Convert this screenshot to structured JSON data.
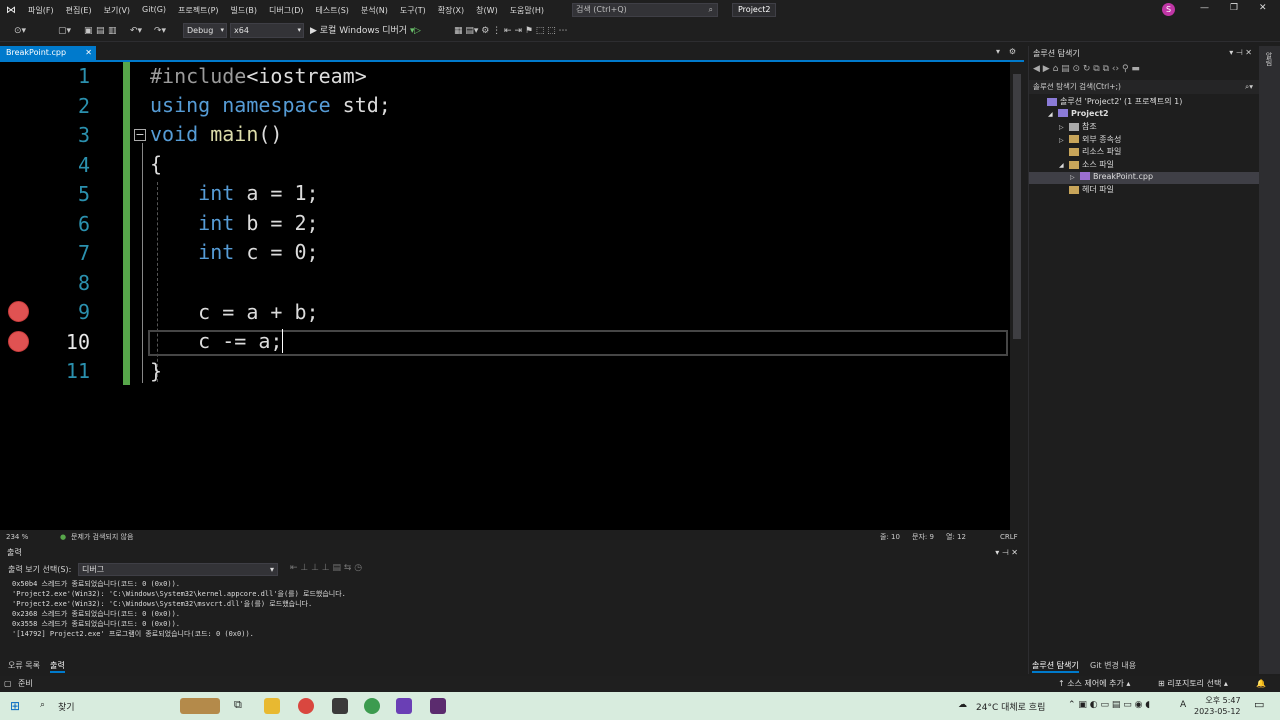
{
  "menu": [
    "파일(F)",
    "편집(E)",
    "보기(V)",
    "Git(G)",
    "프로젝트(P)",
    "빌드(B)",
    "디버그(D)",
    "테스트(S)",
    "분석(N)",
    "도구(T)",
    "확장(X)",
    "창(W)",
    "도움말(H)"
  ],
  "search_placeholder": "검색 (Ctrl+Q)",
  "project_name": "Project2",
  "avatar_letter": "S",
  "toolbar": {
    "config": "Debug",
    "platform": "x64",
    "run_label": "▶ 로컬 Windows 디버거"
  },
  "tab": {
    "file": "BreakPoint.cpp"
  },
  "editor": {
    "lines": [
      "1",
      "2",
      "3",
      "4",
      "5",
      "6",
      "7",
      "8",
      "9",
      "10",
      "11"
    ],
    "current_line": 10,
    "breakpoints": [
      9,
      10
    ],
    "zoom": "234 %",
    "issues": "문제가 검색되지 않음",
    "position": {
      "line": "줄: 10",
      "col": "문자: 9",
      "pos": "열: 12",
      "eol": "CRLF"
    }
  },
  "output": {
    "title": "출력",
    "show_from_label": "출력 보기 선택(S):",
    "show_from": "디버그",
    "lines": [
      "0x50b4 스레드가 종료되었습니다(코드: 0 (0x0)).",
      "'Project2.exe'(Win32): 'C:\\Windows\\System32\\kernel.appcore.dll'을(를) 로드했습니다.",
      "'Project2.exe'(Win32): 'C:\\Windows\\System32\\msvcrt.dll'을(를) 로드했습니다.",
      "0x2368 스레드가 종료되었습니다(코드: 0 (0x0)).",
      "0x3558 스레드가 종료되었습니다(코드: 0 (0x0)).",
      "'[14792] Project2.exe' 프로그램이 종료되었습니다(코드: 0 (0x0))."
    ],
    "tabs": [
      "오류 목록",
      "출력"
    ]
  },
  "solution_explorer": {
    "title": "솔루션 탐색기",
    "search": "솔루션 탐색기 검색(Ctrl+;)",
    "items": [
      {
        "label": "솔루션 'Project2' (1 프로젝트의 1)",
        "indent": 0
      },
      {
        "label": "Project2",
        "indent": 1
      },
      {
        "label": "참조",
        "indent": 2
      },
      {
        "label": "외부 종속성",
        "indent": 2
      },
      {
        "label": "리소스 파일",
        "indent": 2
      },
      {
        "label": "소스 파일",
        "indent": 2
      },
      {
        "label": "BreakPoint.cpp",
        "indent": 3
      },
      {
        "label": "헤더 파일",
        "indent": 2
      }
    ],
    "tabs": [
      "솔루션 탐색기",
      "Git 변경 내용"
    ]
  },
  "right_strip": "알림",
  "status": {
    "ready": "준비",
    "source_control": "↑ 소스 제어에 추가 ▴",
    "repo": "⊞ 리포지토리 선택 ▴"
  },
  "taskbar": {
    "search": "찾기",
    "weather": "24°C 대체로 흐림",
    "time": "오후 5:47",
    "date": "2023-05-12",
    "lang": "A"
  }
}
